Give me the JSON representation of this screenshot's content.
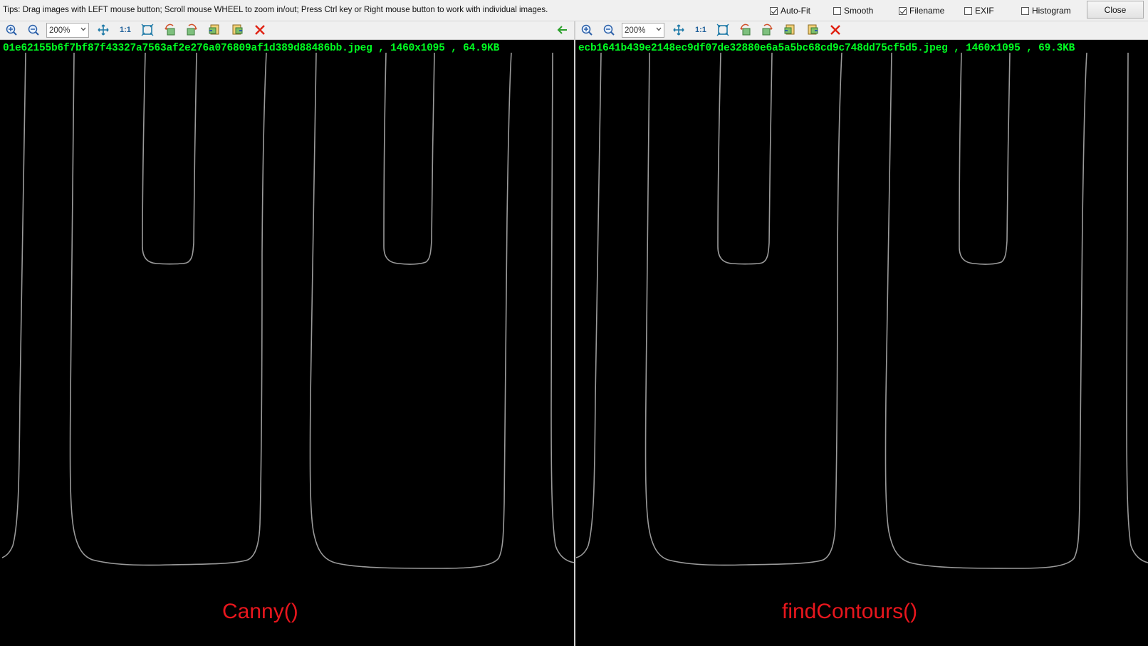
{
  "window": {
    "tips": "Tips: Drag images with LEFT mouse button; Scroll mouse WHEEL to zoom in/out; Press Ctrl key or Right mouse button to work with individual images.",
    "options": [
      {
        "label": "Auto-Fit",
        "checked": true
      },
      {
        "label": "Smooth",
        "checked": false
      },
      {
        "label": "Filename",
        "checked": true
      },
      {
        "label": "EXIF",
        "checked": false
      },
      {
        "label": "Histogram",
        "checked": false
      }
    ],
    "close_label": "Close"
  },
  "left_pane": {
    "zoom": "200%",
    "actual_size_label": "1:1",
    "filename_overlay": "01e62155b6f7bf87f43327a7563af2e276a076809af1d389d88486bb.jpeg , 1460x1095 , 64.9KB",
    "caption": "Canny()"
  },
  "right_pane": {
    "zoom": "200%",
    "actual_size_label": "1:1",
    "filename_overlay": "ecb1641b439e2148ec9df07de32880e6a5a5bc68cd9c748dd75cf5d5.jpeg , 1460x1095 , 69.3KB",
    "caption": "findContours()"
  },
  "icons": [
    "zoom-in-icon",
    "zoom-out-icon",
    "fit-icon",
    "actual-size-icon",
    "fullscreen-icon",
    "rotate-left-icon",
    "rotate-right-icon",
    "prev-image-icon",
    "next-image-icon",
    "delete-icon",
    "sync-arrow-icon"
  ],
  "colors": {
    "filename_text": "#00ff22",
    "caption_text": "#e8161d",
    "edge_lines": "#9a9a9a",
    "background": "#000000"
  }
}
